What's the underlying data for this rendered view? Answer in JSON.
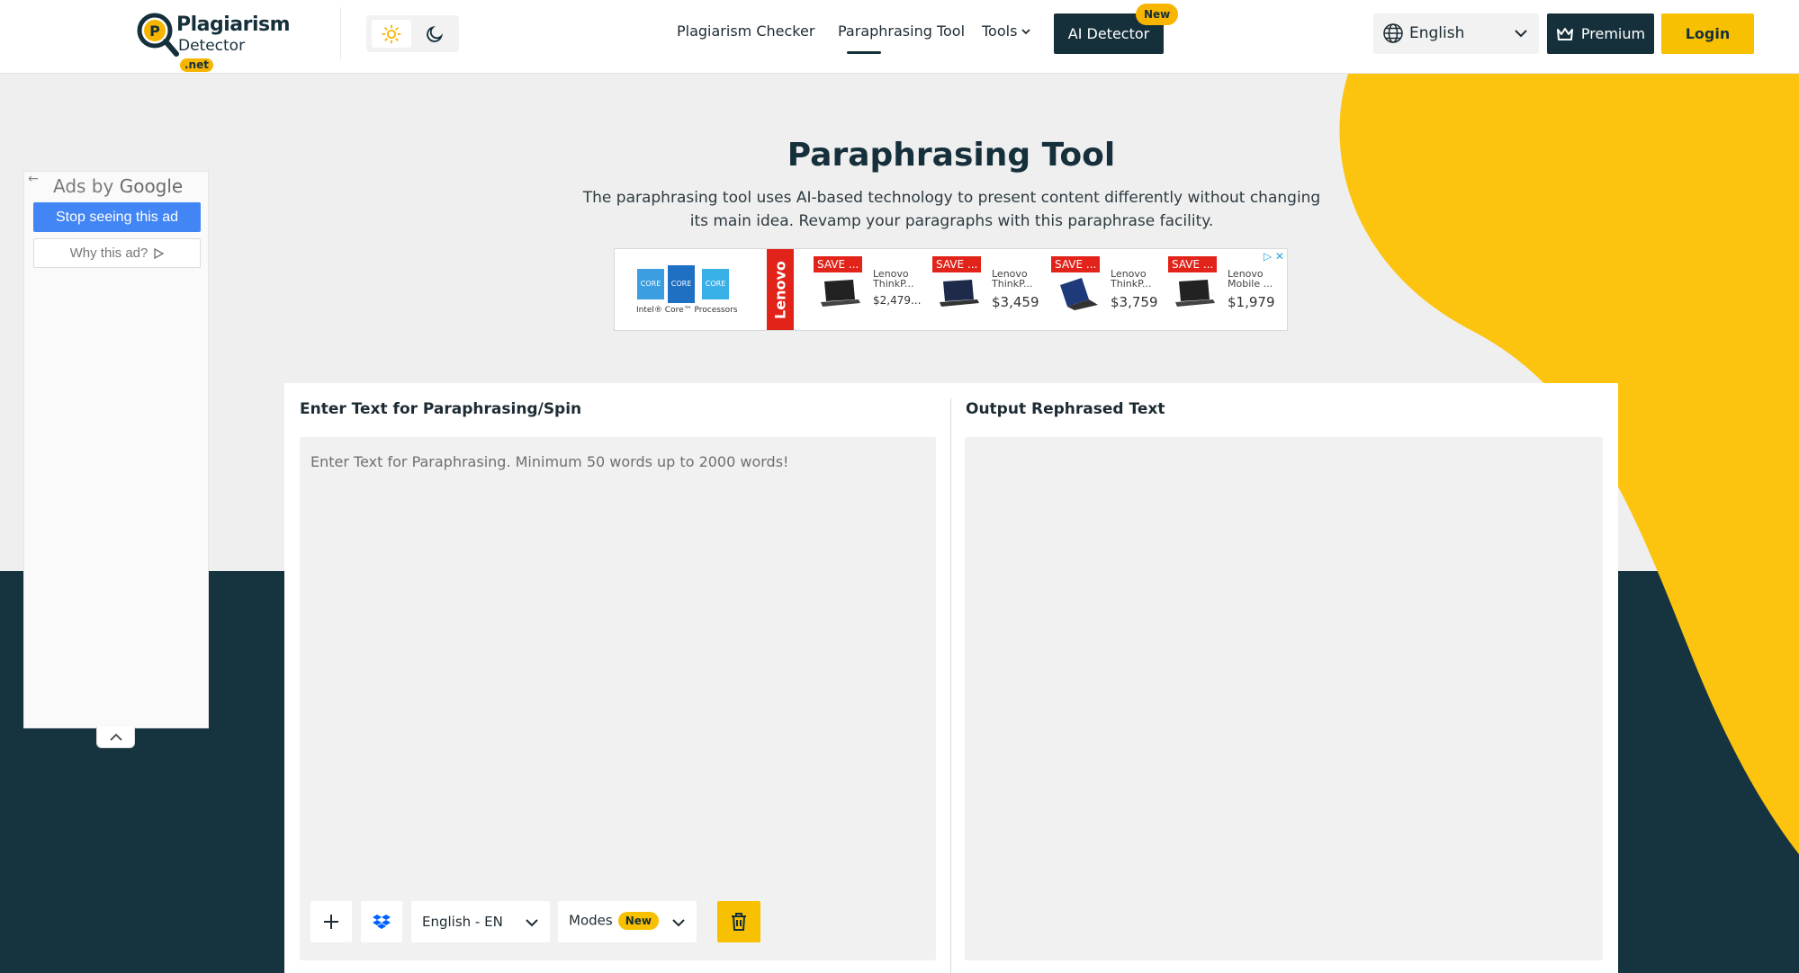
{
  "header": {
    "logo": {
      "line1": "Plagiarism",
      "line2": "Detector",
      "tld": ".net"
    },
    "nav": [
      {
        "label": "Plagiarism Checker"
      },
      {
        "label": "Paraphrasing Tool",
        "active": true
      },
      {
        "label": "Tools"
      }
    ],
    "ai_detector": {
      "label": "AI Detector",
      "badge": "New"
    },
    "language": "English",
    "premium_label": "Premium",
    "login_label": "Login",
    "icons": [
      "sun-icon",
      "moon-icon",
      "globe-icon",
      "chevron-down-icon",
      "crown-icon"
    ]
  },
  "side_ad": {
    "ads_by": "Ads by",
    "google": "Google",
    "stop_label": "Stop seeing this ad",
    "why_label": "Why this ad?"
  },
  "hero": {
    "title": "Paraphrasing Tool",
    "description": "The paraphrasing tool uses AI-based technology to present content differently without changing its main idea. Revamp your paragraphs with this paraphrase facility."
  },
  "banner_ad": {
    "intel_caption": "Intel® Core™ Processors",
    "intel_chips": [
      "CORE",
      "CORE",
      "CORE"
    ],
    "brand": "Lenovo",
    "products": [
      {
        "save": "SAVE ...",
        "name": "Lenovo ThinkP...",
        "price": "$2,479..."
      },
      {
        "save": "SAVE ...",
        "name": "Lenovo ThinkP...",
        "price": "$3,459"
      },
      {
        "save": "SAVE ...",
        "name": "Lenovo ThinkP...",
        "price": "$3,759"
      },
      {
        "save": "SAVE ...",
        "name": "Lenovo Mobile ...",
        "price": "$1,979"
      }
    ]
  },
  "editor": {
    "input_label": "Enter Text for Paraphrasing/Spin",
    "input_placeholder": "Enter Text for Paraphrasing. Minimum 50 words up to 2000 words!",
    "output_label": "Output Rephrased Text",
    "language_option": "English - EN",
    "modes_label": "Modes",
    "modes_badge": "New"
  },
  "colors": {
    "brand_dark": "#16303b",
    "accent_yellow": "#f7c000",
    "ad_blue": "#4285f4"
  }
}
